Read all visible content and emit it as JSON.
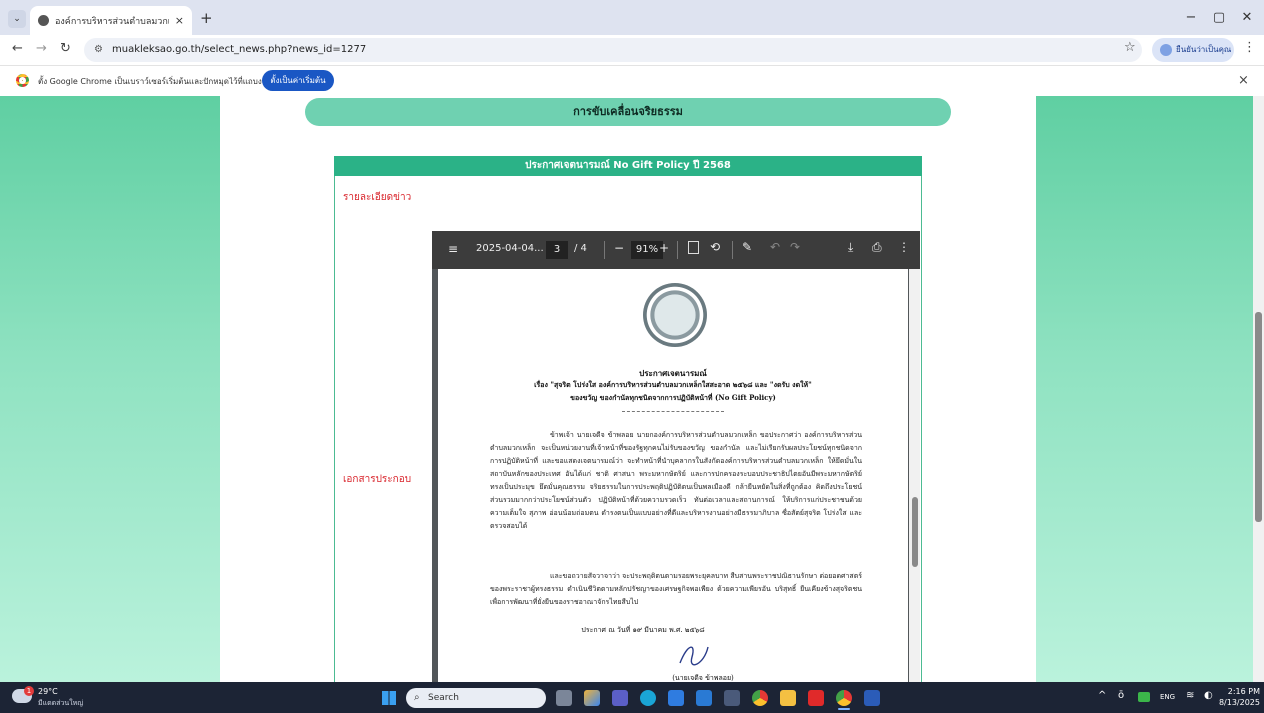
{
  "browser": {
    "tab_title": "องค์การบริหารส่วนตำบลมวกเหล็ก อ",
    "tab_close": "×",
    "new_tab": "+",
    "url": "muakleksao.go.th/select_news.php?news_id=1277",
    "profile_label": "ยืนยันว่าเป็นคุณ",
    "window_controls": [
      "−",
      "▢",
      "✕"
    ]
  },
  "infobar": {
    "message": "ตั้ง Google Chrome เป็นเบราว์เซอร์เริ่มต้นและปักหมุดไว้ที่แถบงาน",
    "button": "ตั้งเป็นค่าเริ่มต้น",
    "close": "×"
  },
  "page": {
    "section_title": "การขับเคลื่อนจริยธรรม",
    "news_title": "ประกาศเจตนารมณ์ No Gift Policy ปี 2568",
    "detail_label": "รายละเอียดข่าว",
    "attachment_label": "เอกสารประกอบ"
  },
  "pdf": {
    "filename": "2025-04-04...",
    "page_current": "3",
    "page_total": "/ 4",
    "zoom_minus": "−",
    "zoom": "91%",
    "zoom_plus": "+"
  },
  "doc": {
    "heading": "ประกาศเจตนารมณ์",
    "subject_line1": "เรื่อง \"สุจริต โปร่งใส องค์การบริหารส่วนตำบลมวกเหล็กใสสะอาด ๒๕๖๘ และ \"งดรับ งดให้\"",
    "subject_line2": "ของขวัญ ของกำนัลทุกชนิดจากการปฏิบัติหน้าที่ (No Gift Policy)",
    "para1": "ข้าพเจ้า นายเจดีจ ข้าพลอย นายกองค์การบริหารส่วนตำบลมวกเหล็ก ขอประกาศว่า องค์การบริหารส่วนตำบลมวกเหล็ก จะเป็นหน่วยงานที่เจ้าหน้าที่ของรัฐทุกคนไม่รับของขวัญ ของกำนัล และไม่เรียกรับผลประโยชน์ทุกชนิดจากการปฏิบัติหน้าที่ และขอแสดงเจตนารมณ์ว่า จะทำหน้าที่นำบุคลากรในสังกัดองค์การบริหารส่วนตำบลมวกเหล็ก ให้ยึดมั่นในสถาบันหลักของประเทศ อันได้แก่ ชาติ ศาสนา พระมหากษัตริย์ และการปกครองระบอบประชาธิปไตยอันมีพระมหากษัตริย์ทรงเป็นประมุข ยึดมั่นคุณธรรม จริยธรรมในการประพฤติปฏิบัติตนเป็นพลเมืองดี กล้ายืนหยัดในสิ่งที่ถูกต้อง คิดถึงประโยชน์ส่วนรวมมากกว่าประโยชน์ส่วนตัว ปฏิบัติหน้าที่ด้วยความรวดเร็ว ทันต่อเวลาและสถานการณ์ ให้บริการแก่ประชาชนด้วยความเต็มใจ สุภาพ อ่อนน้อมถ่อมตน ดำรงตนเป็นแบบอย่างที่ดีและบริหารงานอย่างมีธรรมาภิบาล ซื่อสัตย์สุจริต โปร่งใส และตรวจสอบได้",
    "para2": "และขอถวายสัจวาจาว่า จะประพฤติตนตามรอยพระยุคลบาท สืบสานพระราชปณิธานรักษา ต่อยอดศาสตร์ของพระราชาผู้ทรงธรรม ดำเนินชีวิตตามหลักปรัชญาของเศรษฐกิจพอเพียง ด้วยความเพียรอัน บริสุทธิ์ ยืนเคียงข้างสุจริตชน เพื่อการพัฒนาที่ยั่งยืนของราชอาณาจักรไทยสืบไป",
    "date_line": "ประกาศ ณ วันที่ ๑๙ มีนาคม พ.ศ. ๒๕๖๘",
    "signer": "(นายเจดีจ ข้าพลอย)"
  },
  "taskbar": {
    "temp": "29°C",
    "weather_text": "มีแดดส่วนใหญ่",
    "search_placeholder": "Search",
    "lang": "ENG",
    "time": "2:16 PM",
    "date": "8/13/2025",
    "weather_badge": "1"
  },
  "colors": {
    "accent_green": "#33b07f",
    "header_green": "#2bb287",
    "label_red": "#d9242b",
    "chrome_blue": "#1a57c4"
  }
}
